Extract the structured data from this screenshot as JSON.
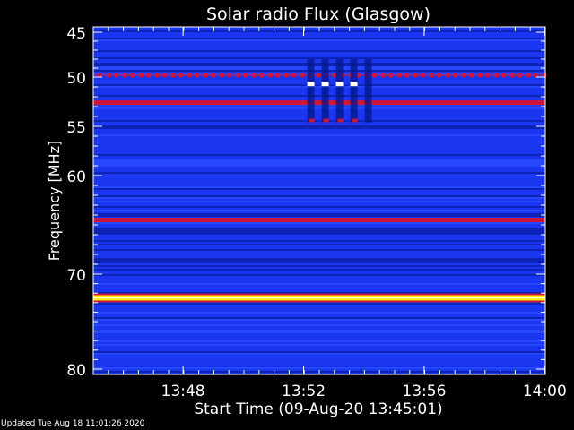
{
  "footer": {
    "updated": "Updated Tue Aug 18 11:01:26 2020"
  },
  "chart_data": {
    "type": "heatmap",
    "title": "Solar radio Flux (Glasgow)",
    "xlabel": "Start Time (09-Aug-20 13:45:01)",
    "ylabel": "Frequency [MHz]",
    "xlim_minutes": [
      0,
      15
    ],
    "ylim_mhz": [
      45,
      80
    ],
    "y_ticks": [
      {
        "mhz": 45,
        "label": "45"
      },
      {
        "mhz": 50,
        "label": "50"
      },
      {
        "mhz": 55,
        "label": "55"
      },
      {
        "mhz": 60,
        "label": "60"
      },
      {
        "mhz": 70,
        "label": "70"
      },
      {
        "mhz": 80,
        "label": "80"
      }
    ],
    "x_ticks": [
      {
        "minute": 2.98,
        "label": "13:48"
      },
      {
        "minute": 6.98,
        "label": "13:52"
      },
      {
        "minute": 10.98,
        "label": "13:56"
      },
      {
        "minute": 14.98,
        "label": "14:00"
      }
    ],
    "colors": {
      "background": "#1a36f0",
      "dark": "#0a1fa8",
      "bright": "#2a4cff",
      "red": "#d0153a",
      "yellow": "#fff200"
    },
    "bands": [
      {
        "mhz": 49.8,
        "level": "red-dotted"
      },
      {
        "mhz": 52.6,
        "level": "red"
      },
      {
        "mhz": 64.5,
        "level": "red"
      },
      {
        "mhz": 72.5,
        "level": "yellow"
      }
    ],
    "burst": {
      "t_start": 7.1,
      "t_end": 9.1,
      "mhz_start": 48.0,
      "mhz_end": 54.6
    }
  }
}
